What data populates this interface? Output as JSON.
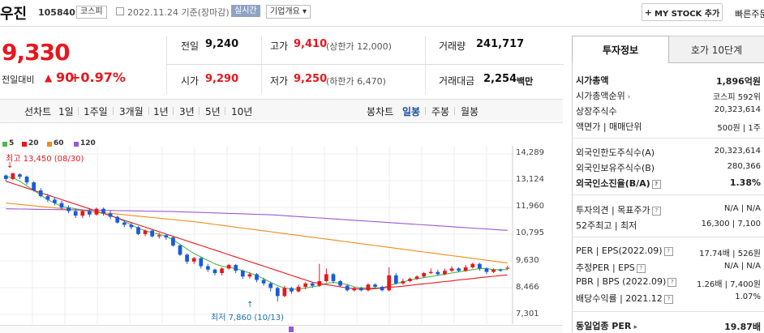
{
  "header": {
    "stock_name": "우진",
    "stock_code": "105840",
    "market": "코스피",
    "date": "2022.11.24",
    "basis": "기준(장마감)",
    "realtime": "실시간",
    "company_info": "기업개요",
    "company_info_arrow": "▾",
    "mystock_plus": "+",
    "mystock_label": "MY STOCK 추가",
    "quick_order": "빠른주문"
  },
  "price": {
    "current": "9,330",
    "change_label": "전일대비",
    "change_arrow": "▲",
    "change": "90",
    "change_pct": "+0.97%"
  },
  "quote": {
    "prev_label": "전일",
    "prev": "9,240",
    "high_label": "고가",
    "high": "9,410",
    "upper_limit": "(상한가 12,000)",
    "volume_label": "거래량",
    "volume": "241,717",
    "open_label": "시가",
    "open": "9,290",
    "low_label": "저가",
    "low": "9,250",
    "lower_limit": "(하한가 6,470)",
    "amount_label": "거래대금",
    "amount": "2,254",
    "amount_unit": "백만"
  },
  "period_bar": {
    "line_chart": "선차트",
    "periods": [
      "1일",
      "1주일",
      "3개월",
      "1년",
      "3년",
      "5년",
      "10년"
    ],
    "candle_chart": "봉차트",
    "candles": [
      "일봉",
      "주봉",
      "월봉"
    ],
    "active_candle": "일봉"
  },
  "chart_data": {
    "type": "candlestick",
    "legend": [
      {
        "name": "5",
        "color": "#4cb848"
      },
      {
        "name": "20",
        "color": "#e8161e"
      },
      {
        "name": "60",
        "color": "#f08c1a"
      },
      {
        "name": "120",
        "color": "#9b59d0"
      }
    ],
    "y_ticks": [
      "14,289",
      "13,124",
      "11,960",
      "10,795",
      "9,630",
      "8,466",
      "7,301"
    ],
    "ylim": [
      7301,
      14289
    ],
    "high_annotation": "최고 13,450 (08/30)",
    "low_annotation": "최저 7,860 (10/13)",
    "candles": [
      [
        13350,
        13200,
        13400,
        13100
      ],
      [
        13200,
        13450,
        13450,
        13150
      ],
      [
        13400,
        13300,
        13450,
        13200
      ],
      [
        13300,
        13050,
        13350,
        12950
      ],
      [
        13050,
        12700,
        13100,
        12650
      ],
      [
        12700,
        12450,
        12800,
        12400
      ],
      [
        12450,
        12300,
        12550,
        12200
      ],
      [
        12300,
        12150,
        12400,
        12050
      ],
      [
        12150,
        11950,
        12250,
        11850
      ],
      [
        11950,
        11800,
        12050,
        11700
      ],
      [
        11800,
        11600,
        11900,
        11500
      ],
      [
        11600,
        11800,
        11850,
        11500
      ],
      [
        11800,
        11650,
        11900,
        11550
      ],
      [
        11650,
        11900,
        11950,
        11600
      ],
      [
        11900,
        11700,
        11950,
        11600
      ],
      [
        11700,
        11550,
        11800,
        11450
      ],
      [
        11550,
        11300,
        11600,
        11250
      ],
      [
        11300,
        11200,
        11400,
        11100
      ],
      [
        11200,
        11100,
        11300,
        11000
      ],
      [
        11100,
        10800,
        11150,
        10750
      ],
      [
        10800,
        10950,
        11000,
        10700
      ],
      [
        10950,
        10700,
        11000,
        10650
      ],
      [
        10700,
        10750,
        10850,
        10600
      ],
      [
        10750,
        10650,
        10800,
        10550
      ],
      [
        10650,
        10300,
        10700,
        10250
      ],
      [
        10300,
        9900,
        10350,
        9850
      ],
      [
        9900,
        9600,
        9950,
        9500
      ],
      [
        9600,
        9750,
        9800,
        9500
      ],
      [
        9750,
        9400,
        9800,
        9300
      ],
      [
        9400,
        9250,
        9500,
        9150
      ],
      [
        9250,
        9100,
        9300,
        9000
      ],
      [
        9100,
        9300,
        9350,
        9000
      ],
      [
        9300,
        9450,
        9500,
        9250
      ],
      [
        9450,
        9200,
        9500,
        9100
      ],
      [
        9200,
        8950,
        9250,
        8850
      ],
      [
        8950,
        9050,
        9150,
        8850
      ],
      [
        9050,
        8800,
        9100,
        8700
      ],
      [
        8800,
        8650,
        8900,
        8550
      ],
      [
        8650,
        8450,
        8700,
        8300
      ],
      [
        8450,
        8100,
        8500,
        7860
      ],
      [
        8100,
        8450,
        8550,
        8050
      ],
      [
        8450,
        8300,
        8500,
        8200
      ],
      [
        8300,
        8500,
        8600,
        8250
      ],
      [
        8500,
        8650,
        8700,
        8400
      ],
      [
        8650,
        8550,
        8700,
        8450
      ],
      [
        8550,
        8750,
        9500,
        8500
      ],
      [
        8750,
        9050,
        9300,
        8700
      ],
      [
        9050,
        8750,
        9100,
        8650
      ],
      [
        8750,
        8550,
        8800,
        8500
      ],
      [
        8550,
        8350,
        8600,
        8300
      ],
      [
        8350,
        8450,
        8500,
        8300
      ],
      [
        8450,
        8350,
        8500,
        8300
      ],
      [
        8350,
        8600,
        8650,
        8300
      ],
      [
        8600,
        8500,
        8650,
        8450
      ],
      [
        8500,
        8350,
        8550,
        8300
      ],
      [
        8350,
        9000,
        9350,
        8300
      ],
      [
        9000,
        8650,
        9100,
        8600
      ],
      [
        8650,
        8750,
        8850,
        8600
      ],
      [
        8750,
        8850,
        8900,
        8700
      ],
      [
        8850,
        8950,
        9000,
        8800
      ],
      [
        8950,
        9100,
        9150,
        8900
      ],
      [
        9100,
        9150,
        9300,
        9050
      ],
      [
        9150,
        9050,
        9250,
        9000
      ],
      [
        9050,
        9200,
        9300,
        9000
      ],
      [
        9200,
        9300,
        9400,
        9150
      ],
      [
        9300,
        9200,
        9350,
        9150
      ],
      [
        9200,
        9350,
        9450,
        9150
      ],
      [
        9350,
        9500,
        9550,
        9300
      ],
      [
        9500,
        9300,
        9550,
        9200
      ],
      [
        9300,
        9150,
        9350,
        9050
      ],
      [
        9150,
        9250,
        9300,
        9100
      ],
      [
        9250,
        9200,
        9300,
        9150
      ],
      [
        9290,
        9330,
        9410,
        9250
      ]
    ],
    "ma": {
      "5": [
        13300,
        13250,
        13100,
        12900,
        12700,
        12500,
        12300,
        12150,
        12000,
        11950,
        11900,
        11850,
        11800,
        11750,
        11700,
        11600,
        11500,
        11350,
        11200,
        11050,
        10950,
        10850,
        10800,
        10700,
        10550,
        10350,
        10150,
        9950,
        9800,
        9650,
        9500,
        9400,
        9350,
        9300,
        9200,
        9100,
        9000,
        8850,
        8700,
        8550,
        8450,
        8400,
        8400,
        8450,
        8500,
        8550,
        8650,
        8700,
        8650,
        8600,
        8500,
        8450,
        8450,
        8450,
        8450,
        8550,
        8650,
        8700,
        8800,
        8850,
        8900,
        8950,
        9000,
        9050,
        9100,
        9150,
        9200,
        9250,
        9300,
        9300,
        9250,
        9250,
        9250
      ],
      "20": [
        13100,
        13000,
        12900,
        12800,
        12700,
        12600,
        12500,
        12400,
        12300,
        12200,
        12100,
        12000,
        11900,
        11800,
        11700,
        11600,
        11500,
        11400,
        11300,
        11200,
        11100,
        11000,
        10900,
        10800,
        10700,
        10600,
        10500,
        10400,
        10300,
        10200,
        10100,
        10000,
        9900,
        9800,
        9700,
        9600,
        9500,
        9400,
        9300,
        9200,
        9100,
        9000,
        8900,
        8800,
        8700,
        8650,
        8600,
        8550,
        8500,
        8450,
        8420,
        8400,
        8400,
        8420,
        8450,
        8480,
        8500,
        8530,
        8560,
        8600,
        8630,
        8660,
        8700,
        8730,
        8760,
        8800,
        8830,
        8860,
        8900,
        8930,
        8960,
        8990,
        9020
      ],
      "60": [
        12150,
        12120,
        12090,
        12060,
        12030,
        12000,
        11970,
        11940,
        11910,
        11880,
        11850,
        11820,
        11790,
        11760,
        11730,
        11700,
        11670,
        11640,
        11610,
        11580,
        11550,
        11520,
        11490,
        11460,
        11430,
        11400,
        11370,
        11340,
        11300,
        11260,
        11220,
        11180,
        11140,
        11100,
        11060,
        11020,
        10980,
        10940,
        10900,
        10860,
        10820,
        10780,
        10740,
        10700,
        10660,
        10620,
        10580,
        10540,
        10500,
        10460,
        10420,
        10380,
        10340,
        10300,
        10260,
        10220,
        10180,
        10140,
        10100,
        10060,
        10020,
        9980,
        9940,
        9900,
        9860,
        9820,
        9780,
        9740,
        9700,
        9660,
        9620,
        9580,
        9540
      ],
      "120": [
        11900,
        11895,
        11890,
        11885,
        11880,
        11875,
        11870,
        11865,
        11860,
        11855,
        11850,
        11845,
        11840,
        11835,
        11830,
        11825,
        11820,
        11815,
        11810,
        11805,
        11800,
        11795,
        11790,
        11785,
        11780,
        11770,
        11760,
        11750,
        11740,
        11730,
        11720,
        11710,
        11700,
        11690,
        11680,
        11670,
        11660,
        11650,
        11640,
        11620,
        11600,
        11580,
        11560,
        11540,
        11520,
        11500,
        11480,
        11460,
        11440,
        11420,
        11400,
        11380,
        11360,
        11340,
        11320,
        11300,
        11280,
        11260,
        11240,
        11220,
        11200,
        11180,
        11160,
        11140,
        11120,
        11100,
        11080,
        11060,
        11040,
        11020,
        11000,
        10980,
        10960
      ]
    }
  },
  "invest": {
    "tab_active": "투자정보",
    "tab_other": "호가 10단계",
    "rows1": [
      {
        "label": "시가총액",
        "value": "1,896억원",
        "bold": true
      },
      {
        "label": "시가총액순위",
        "value": "코스피 592위"
      },
      {
        "label": "상장주식수",
        "value": "20,323,614"
      },
      {
        "label": "액면가 | 매매단위",
        "value": "500원 | 1주"
      }
    ],
    "rows2": [
      {
        "label": "외국인한도주식수(A)",
        "value": "20,323,614"
      },
      {
        "label": "외국인보유주식수(B)",
        "value": "280,366"
      },
      {
        "label": "외국인소진율(B/A)",
        "value": "1.38%",
        "bold": true
      }
    ],
    "rows3": [
      {
        "label": "투자의견 | 목표주가",
        "value": "N/A | N/A"
      },
      {
        "label": "52주최고 | 최저",
        "value": "16,300 | 7,100"
      }
    ],
    "rows4": [
      {
        "label": "PER | EPS(2022.09)",
        "value": "17.74배 | 526원"
      },
      {
        "label": "추정PER | EPS",
        "value": "N/A | N/A"
      },
      {
        "label": "PBR | BPS (2022.09)",
        "value": "1.26배 | 7,400원"
      },
      {
        "label": "배당수익률 | 2021.12",
        "value": "1.07%"
      }
    ],
    "industry_label": "동일업종 PER",
    "industry_value": "19.87배"
  }
}
